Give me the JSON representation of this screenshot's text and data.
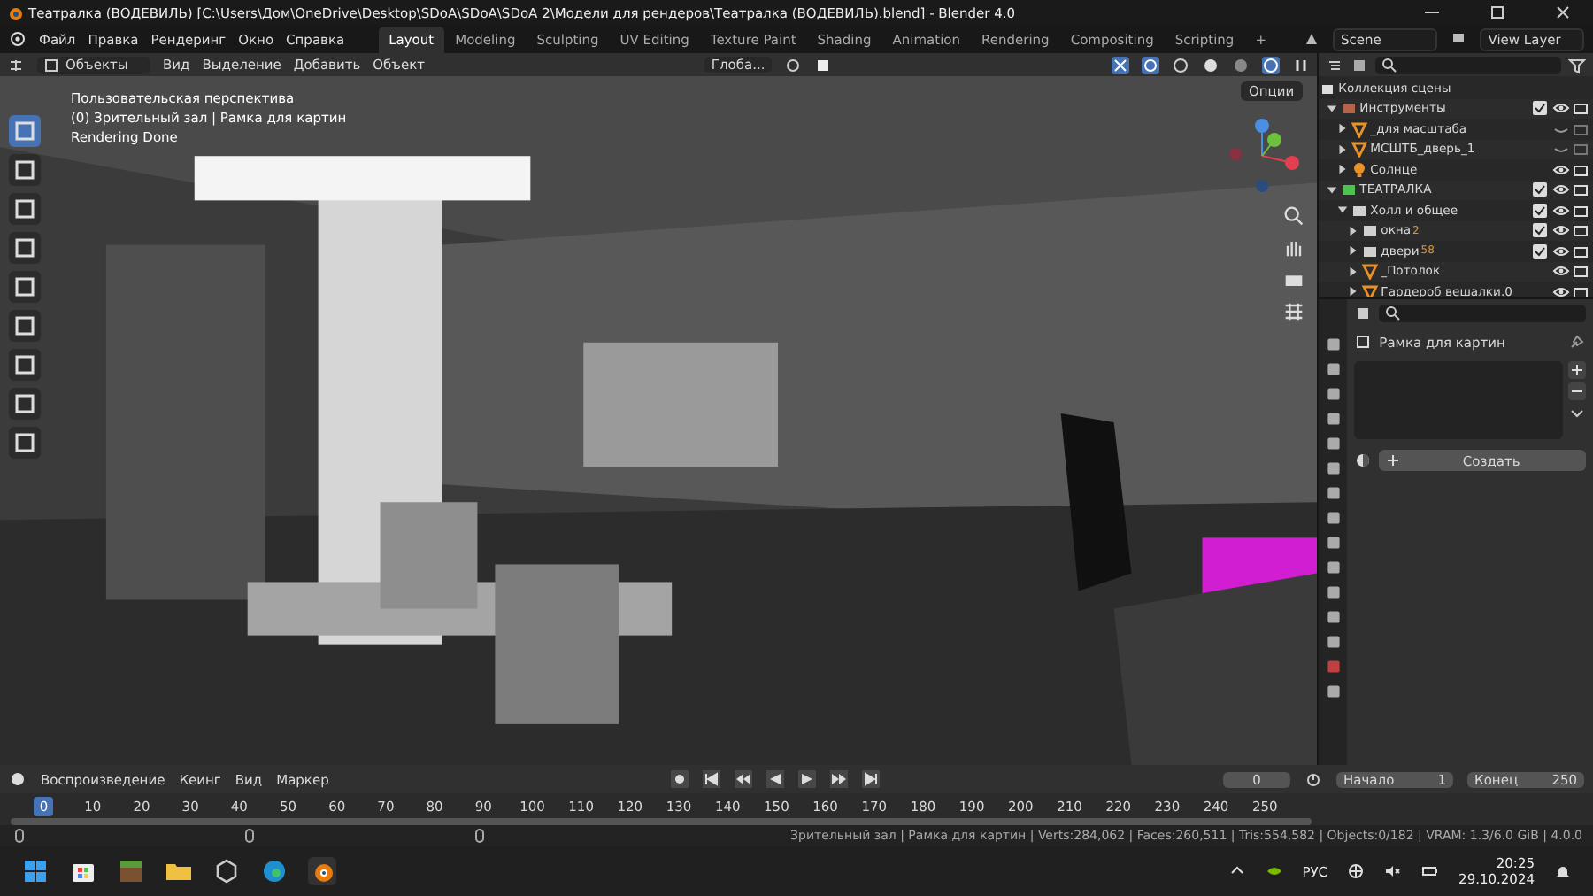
{
  "window": {
    "title": "Театралка (ВОДЕВИЛЬ) [C:\\Users\\Дом\\OneDrive\\Desktop\\SDoA\\SDoA\\SDoA 2\\Модели для рендеров\\Театралка (ВОДЕВИЛЬ).blend] - Blender 4.0"
  },
  "menu": [
    "Файл",
    "Правка",
    "Рендеринг",
    "Окно",
    "Справка"
  ],
  "workspaces": [
    {
      "label": "Layout",
      "selected": true
    },
    {
      "label": "Modeling",
      "selected": false
    },
    {
      "label": "Sculpting",
      "selected": false
    },
    {
      "label": "UV Editing",
      "selected": false
    },
    {
      "label": "Texture Paint",
      "selected": false
    },
    {
      "label": "Shading",
      "selected": false
    },
    {
      "label": "Animation",
      "selected": false
    },
    {
      "label": "Rendering",
      "selected": false
    },
    {
      "label": "Compositing",
      "selected": false
    },
    {
      "label": "Scripting",
      "selected": false
    }
  ],
  "add_workspace": "+",
  "scene": "Scene",
  "view_layer": "View Layer",
  "header": {
    "mode": "Объекты",
    "menus": [
      "Вид",
      "Выделение",
      "Добавить",
      "Объект"
    ],
    "orientation": "Глоба..."
  },
  "viewport": {
    "info": [
      "Пользовательская перспектива",
      "(0) Зрительный зал | Рамка для картин",
      "Rendering Done"
    ],
    "options": "Опции"
  },
  "outliner": {
    "root": "Коллекция сцены",
    "items": [
      {
        "kind": "collection",
        "name": "Инструменты",
        "color": "#b5644a",
        "checked": true,
        "visible": true,
        "expanded": true,
        "children": [
          {
            "kind": "mesh",
            "name": "_для масштаба",
            "visible": false,
            "expanded": false
          },
          {
            "kind": "mesh",
            "name": "МСШТБ_дверь_1",
            "visible": false,
            "expanded": false
          },
          {
            "kind": "light",
            "name": "Солнце",
            "visible": true,
            "expanded": false
          }
        ]
      },
      {
        "kind": "collection",
        "name": "ТЕАТРАЛКА",
        "color": "#4cc34c",
        "checked": true,
        "visible": true,
        "expanded": true,
        "children": [
          {
            "kind": "collection",
            "name": "Холл и общее",
            "color": "#d0d0d0",
            "checked": true,
            "visible": true,
            "expanded": true,
            "children": [
              {
                "kind": "collection",
                "name": "окна",
                "color": "#d0d0d0",
                "checked": true,
                "visible": true,
                "expanded": false,
                "count": "2"
              },
              {
                "kind": "collection",
                "name": "двери",
                "color": "#d0d0d0",
                "checked": true,
                "visible": true,
                "expanded": false,
                "count": "58"
              },
              {
                "kind": "mesh",
                "name": "_Потолок",
                "visible": true,
                "expanded": false
              },
              {
                "kind": "mesh",
                "name": "Гардероб вешалки.0",
                "visible": true,
                "expanded": false
              }
            ]
          }
        ]
      }
    ]
  },
  "properties": {
    "object": "Рамка для картин",
    "create": "Создать"
  },
  "timeline": {
    "menus": [
      "Воспроизведение",
      "Кеинг",
      "Вид",
      "Маркер"
    ],
    "frame": "0",
    "start_label": "Начало",
    "start": "1",
    "end_label": "Конец",
    "end": "250",
    "ticks": [
      {
        "label": "0",
        "selected": true
      },
      {
        "label": "10",
        "selected": false
      },
      {
        "label": "20",
        "selected": false
      },
      {
        "label": "30",
        "selected": false
      },
      {
        "label": "40",
        "selected": false
      },
      {
        "label": "50",
        "selected": false
      },
      {
        "label": "60",
        "selected": false
      },
      {
        "label": "70",
        "selected": false
      },
      {
        "label": "80",
        "selected": false
      },
      {
        "label": "90",
        "selected": false
      },
      {
        "label": "100",
        "selected": false
      },
      {
        "label": "110",
        "selected": false
      },
      {
        "label": "120",
        "selected": false
      },
      {
        "label": "130",
        "selected": false
      },
      {
        "label": "140",
        "selected": false
      },
      {
        "label": "150",
        "selected": false
      },
      {
        "label": "160",
        "selected": false
      },
      {
        "label": "170",
        "selected": false
      },
      {
        "label": "180",
        "selected": false
      },
      {
        "label": "190",
        "selected": false
      },
      {
        "label": "200",
        "selected": false
      },
      {
        "label": "210",
        "selected": false
      },
      {
        "label": "220",
        "selected": false
      },
      {
        "label": "230",
        "selected": false
      },
      {
        "label": "240",
        "selected": false
      },
      {
        "label": "250",
        "selected": false
      }
    ]
  },
  "status_bar": "Зрительный зал | Рамка для картин | Verts:284,062 | Faces:260,511 | Tris:554,582 | Objects:0/182 | VRAM: 1.3/6.0 GiB | 4.0.0",
  "taskbar": {
    "language": "РУС",
    "time": "20:25",
    "date": "29.10.2024"
  }
}
